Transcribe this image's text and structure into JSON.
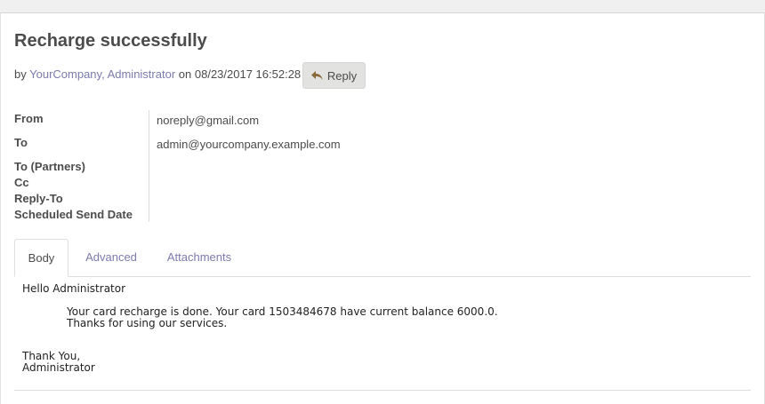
{
  "message": {
    "title": "Recharge successfully",
    "by_prefix": "by",
    "author": "YourCompany, Administrator",
    "on_text": "on",
    "date": "08/23/2017 16:52:28",
    "reply_label": "Reply"
  },
  "fields": {
    "from_label": "From",
    "from_value": "noreply@gmail.com",
    "to_label": "To",
    "to_value": "admin@yourcompany.example.com",
    "to_partners_label": "To (Partners)",
    "cc_label": "Cc",
    "reply_to_label": "Reply-To",
    "scheduled_label": "Scheduled Send Date"
  },
  "tabs": [
    {
      "label": "Body",
      "active": true
    },
    {
      "label": "Advanced",
      "active": false
    },
    {
      "label": "Attachments",
      "active": false
    }
  ],
  "body": {
    "greeting": "Hello Administrator",
    "line1": "Your card recharge is done. Your card 1503484678 have current balance 6000.0.",
    "line2": "Thanks for using our services.",
    "closing": "Thank You,",
    "signature": "Administrator"
  },
  "colors": {
    "link": "#7c7bad",
    "text": "#4c4c4c",
    "button_bg": "#e2e2e0"
  },
  "icons": {
    "reply": "reply-arrow-icon"
  }
}
